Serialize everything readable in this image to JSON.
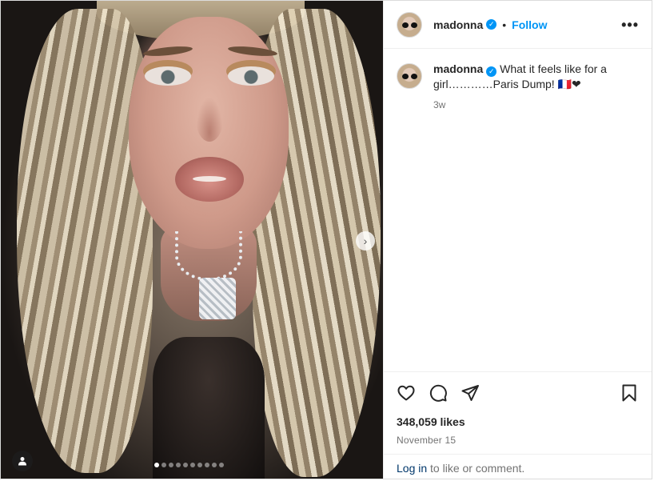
{
  "post": {
    "username": "madonna",
    "verified": true,
    "follow_label": "Follow",
    "separator": "•",
    "more_label": "•••",
    "caption": {
      "username": "madonna",
      "text": " What it feels like for a girl…………Paris Dump! 🇫🇷❤",
      "relative_time": "3w"
    },
    "likes": "348,059 likes",
    "date": "November 15",
    "login": {
      "link": "Log in",
      "text": " to like or comment."
    }
  },
  "carousel": {
    "total_slides": 10,
    "active_slide": 1,
    "next_label": "›"
  },
  "icons": {
    "like": "heart-icon",
    "comment": "comment-icon",
    "share": "share-icon",
    "save": "bookmark-icon",
    "tag": "user-tag-icon"
  },
  "colors": {
    "accent": "#0095f6",
    "text": "#262626",
    "muted": "#737373",
    "link": "#00376b"
  }
}
